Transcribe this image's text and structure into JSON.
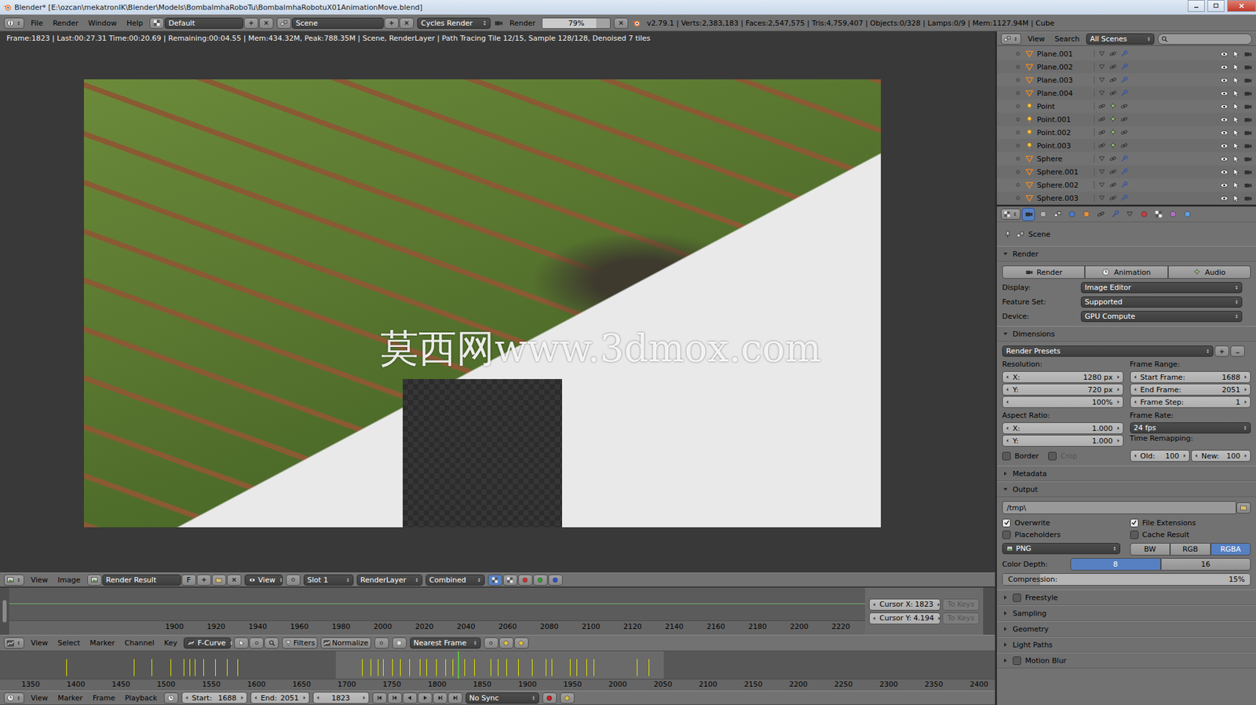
{
  "window": {
    "title": "Blender* [E:\\ozcan\\mekatronIK\\Blender\\Models\\BombalmhaRoboTu\\BombalmhaRobotuX01AnimationMove.blend]"
  },
  "info_header": {
    "menus": [
      "File",
      "Render",
      "Window",
      "Help"
    ],
    "layout": "Default",
    "scene": "Scene",
    "engine": "Cycles Render",
    "render_label": "Render",
    "progress": {
      "level": 0.79,
      "reading": "79%"
    },
    "stats": "v2.79.1 | Verts:2,383,183 | Faces:2,547,575 | Tris:4,759,407 | Objects:0/328 | Lamps:0/9 | Mem:1127.94M | Cube"
  },
  "image_editor": {
    "status": "Frame:1823 | Last:00:27.31 Time:00:20.69 | Remaining:00:04.55 | Mem:434.32M, Peak:788.35M | Scene, RenderLayer | Path Tracing Tile 12/15, Sample 128/128, Denoised 7 tiles",
    "watermark": "莫西网www.3dmox.com",
    "header": {
      "menus": [
        "View",
        "Image"
      ],
      "image": "Render Result",
      "fake_user": "F",
      "view": "View",
      "slot": "Slot 1",
      "layer": "RenderLayer",
      "pass": "Combined"
    }
  },
  "curve_editor": {
    "ticks": [
      "1900",
      "1920",
      "1940",
      "1960",
      "1980",
      "2000",
      "2020",
      "2040",
      "2060",
      "2080",
      "2100",
      "2120",
      "2140",
      "2160",
      "2180",
      "2200",
      "2220"
    ],
    "cursor_x": {
      "label": "Cursor X:",
      "value": "1823",
      "button": "To Keys",
      "disabled": true
    },
    "cursor_y": {
      "label": "Cursor Y:",
      "value": "4.194",
      "button": "To Keys",
      "disabled": true
    }
  },
  "graph_header": {
    "menus": [
      "View",
      "Select",
      "Marker",
      "Channel",
      "Key"
    ],
    "mode": "F-Curve",
    "filters": "Filters",
    "normalize": {
      "label": "Normalize",
      "on": false
    },
    "snap": "Nearest Frame"
  },
  "timeline": {
    "ticks": [
      "1350",
      "1400",
      "1450",
      "1500",
      "1550",
      "1600",
      "1650",
      "1700",
      "1750",
      "1800",
      "1850",
      "1900",
      "1950",
      "2000",
      "2050",
      "2100",
      "2150",
      "2200",
      "2250",
      "2300",
      "2350",
      "2400"
    ],
    "range": {
      "start": 1688,
      "end": 2051
    },
    "current_frame": 1823,
    "keyframes": [
      1389,
      1464,
      1484,
      1505,
      1519,
      1526,
      1532,
      1541,
      1554,
      1567,
      1579,
      1717,
      1726,
      1734,
      1740,
      1750,
      1759,
      1769,
      1781,
      1788,
      1799,
      1809,
      1817,
      1830,
      1841,
      1859,
      1867,
      1877,
      1890,
      1905,
      1920,
      1927,
      1947,
      1954,
      1965,
      1973,
      2021,
      2034
    ]
  },
  "bottom_header": {
    "menus": [
      "View",
      "Marker",
      "Frame",
      "Playback"
    ],
    "start": {
      "label": "Start:",
      "value": "1688"
    },
    "end": {
      "label": "End:",
      "value": "2051"
    },
    "frame": "1823",
    "sync": "No Sync"
  },
  "outliner": {
    "menus": [
      "View",
      "Search"
    ],
    "filter": "All Scenes",
    "rows": [
      {
        "name": "Plane.001",
        "kind": "mesh",
        "visible": true
      },
      {
        "name": "Plane.002",
        "kind": "mesh",
        "visible": true
      },
      {
        "name": "Plane.003",
        "kind": "mesh",
        "visible": true
      },
      {
        "name": "Plane.004",
        "kind": "mesh",
        "visible": true
      },
      {
        "name": "Point",
        "kind": "lamp",
        "visible": true
      },
      {
        "name": "Point.001",
        "kind": "lamp",
        "visible": true
      },
      {
        "name": "Point.002",
        "kind": "lamp",
        "visible": true
      },
      {
        "name": "Point.003",
        "kind": "lamp",
        "visible": true
      },
      {
        "name": "Sphere",
        "kind": "mesh",
        "visible": true
      },
      {
        "name": "Sphere.001",
        "kind": "mesh",
        "visible": true
      },
      {
        "name": "Sphere.002",
        "kind": "mesh",
        "visible": true
      },
      {
        "name": "Sphere.003",
        "kind": "mesh",
        "visible": true
      }
    ]
  },
  "properties": {
    "tabs": [
      {
        "selected": true
      },
      {
        "selected": false
      },
      {
        "selected": false
      },
      {
        "selected": false
      },
      {
        "selected": false
      },
      {
        "selected": false
      },
      {
        "selected": false
      },
      {
        "selected": false
      },
      {
        "selected": false
      },
      {
        "selected": false
      },
      {
        "selected": false
      },
      {
        "selected": false
      }
    ],
    "context": "Scene",
    "render_panel": {
      "title": "Render",
      "expanded": true,
      "buttons": [
        "Render",
        "Animation",
        "Audio"
      ],
      "fields": [
        {
          "label": "Display:",
          "value": "Image Editor"
        },
        {
          "label": "Feature Set:",
          "value": "Supported"
        },
        {
          "label": "Device:",
          "value": "GPU Compute"
        }
      ]
    },
    "dimensions_panel": {
      "title": "Dimensions",
      "expanded": true,
      "presets": "Render Presets",
      "resolution": {
        "label": "Resolution:",
        "x": {
          "label": "X:",
          "value": "1280 px"
        },
        "y": {
          "label": "Y:",
          "value": "720 px"
        },
        "percent": "100%"
      },
      "frame_range": {
        "label": "Frame Range:",
        "fields": [
          {
            "label": "Start Frame:",
            "value": "1688"
          },
          {
            "label": "End Frame:",
            "value": "2051"
          },
          {
            "label": "Frame Step:",
            "value": "1"
          }
        ]
      },
      "aspect": {
        "label": "Aspect Ratio:",
        "x": {
          "label": "X:",
          "value": "1.000"
        },
        "y": {
          "label": "Y:",
          "value": "1.000"
        }
      },
      "frame_rate": {
        "label": "Frame Rate:",
        "value": "24 fps"
      },
      "border": {
        "label": "Border",
        "checked": false
      },
      "crop": {
        "label": "Crop",
        "checked": false,
        "disabled": true
      },
      "time_remapping": {
        "label": "Time Remapping:",
        "old": {
          "label": "Old:",
          "value": "100"
        },
        "new": {
          "label": "New:",
          "value": "100"
        }
      }
    },
    "metadata_panel": {
      "title": "Metadata",
      "expanded": false
    },
    "output_panel": {
      "title": "Output",
      "expanded": true,
      "path": "/tmp\\",
      "checks": [
        {
          "label": "Overwrite",
          "checked": true
        },
        {
          "label": "File Extensions",
          "checked": true
        },
        {
          "label": "Placeholders",
          "checked": false
        },
        {
          "label": "Cache Result",
          "checked": false
        }
      ],
      "format": "PNG",
      "color_modes": [
        {
          "label": "BW",
          "selected": false
        },
        {
          "label": "RGB",
          "selected": false
        },
        {
          "label": "RGBA",
          "selected": true
        }
      ],
      "color_depth": {
        "label": "Color Depth:",
        "options": [
          {
            "label": "8",
            "selected": true
          },
          {
            "label": "16",
            "selected": false
          }
        ]
      },
      "compression": {
        "label": "Compression:",
        "reading": "15%",
        "level": 0.15
      }
    },
    "collapsed_panels": [
      {
        "title": "Freestyle",
        "expanded": false,
        "has_toggle": true,
        "checked": false
      },
      {
        "title": "Sampling",
        "expanded": false,
        "has_toggle": false,
        "checked": false
      },
      {
        "title": "Geometry",
        "expanded": false,
        "has_toggle": false,
        "checked": false
      },
      {
        "title": "Light Paths",
        "expanded": false,
        "has_toggle": false,
        "checked": false
      },
      {
        "title": "Motion Blur",
        "expanded": false,
        "has_toggle": true,
        "checked": false
      }
    ]
  }
}
